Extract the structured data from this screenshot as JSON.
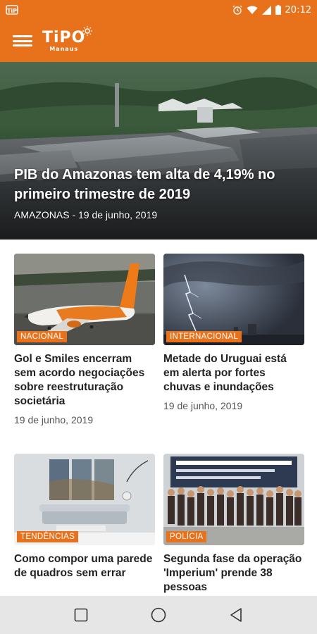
{
  "status_bar": {
    "time": "20:12",
    "icons": [
      "notification-app-icon",
      "alarm-icon",
      "wifi-icon",
      "signal-icon",
      "battery-icon"
    ]
  },
  "app_bar": {
    "logo_main": "TiPO",
    "logo_sub": "Manaus",
    "menu_icon": "hamburger-menu-icon"
  },
  "colors": {
    "accent": "#e8711c",
    "nav_background": "#e6e6e6",
    "title_text": "#222222",
    "meta_text": "#555555"
  },
  "hero": {
    "title": "PIB do Amazonas tem alta de 4,19% no primeiro trimestre de 2019",
    "meta": "AMAZONAS - 19 de junho, 2019"
  },
  "articles": [
    {
      "tag": "NACIONAL",
      "title": "Gol e Smiles encerram sem acordo negociações sobre reestruturação societária",
      "date": "19 de junho, 2019"
    },
    {
      "tag": "INTERNACIONAL",
      "title": "Metade do Uruguai está em alerta por fortes chuvas e inundações",
      "date": "19 de junho, 2019"
    },
    {
      "tag": "TENDÊNCIAS",
      "title": "Como compor uma parede de quadros sem errar",
      "date": ""
    },
    {
      "tag": "POLÍCIA",
      "title": "Segunda fase da operação 'Imperium' prende 38 pessoas",
      "date": ""
    }
  ],
  "nav_bar": {
    "icons": [
      "recent-apps-icon",
      "home-icon",
      "back-icon"
    ]
  }
}
